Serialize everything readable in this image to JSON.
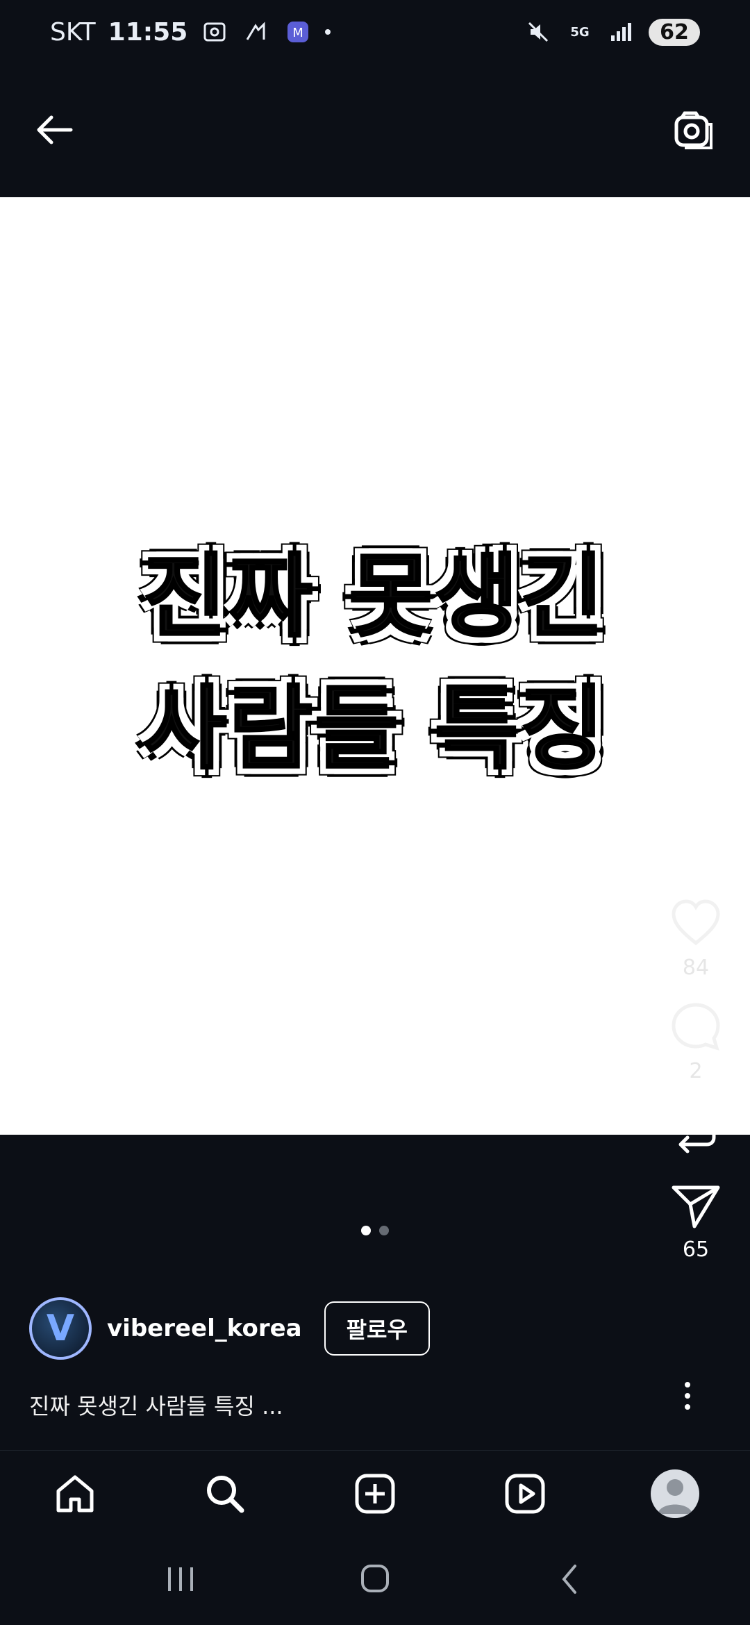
{
  "status_bar": {
    "carrier": "SKT",
    "time": "11:55",
    "network": "5G",
    "battery": "62"
  },
  "post": {
    "title_line1": "진짜 못생긴",
    "title_line2": "사람들 특징",
    "username": "vibereel_korea",
    "follow_label": "팔로우",
    "caption": "진짜 못생긴 사람들 특징 ...",
    "likes": "84",
    "comments": "2",
    "shares": "65",
    "carousel_pages": 2,
    "carousel_active": 1
  },
  "colors": {
    "background": "#0c0f16",
    "media_bg": "#ffffff",
    "text": "#ffffff"
  },
  "icons": {
    "back": "arrow-left-icon",
    "camera": "camera-icon",
    "like": "heart-icon",
    "comment": "comment-icon",
    "repost": "repost-icon",
    "share": "send-icon",
    "more": "more-vertical-icon"
  },
  "nav": [
    "home",
    "search",
    "create",
    "reels",
    "profile"
  ]
}
